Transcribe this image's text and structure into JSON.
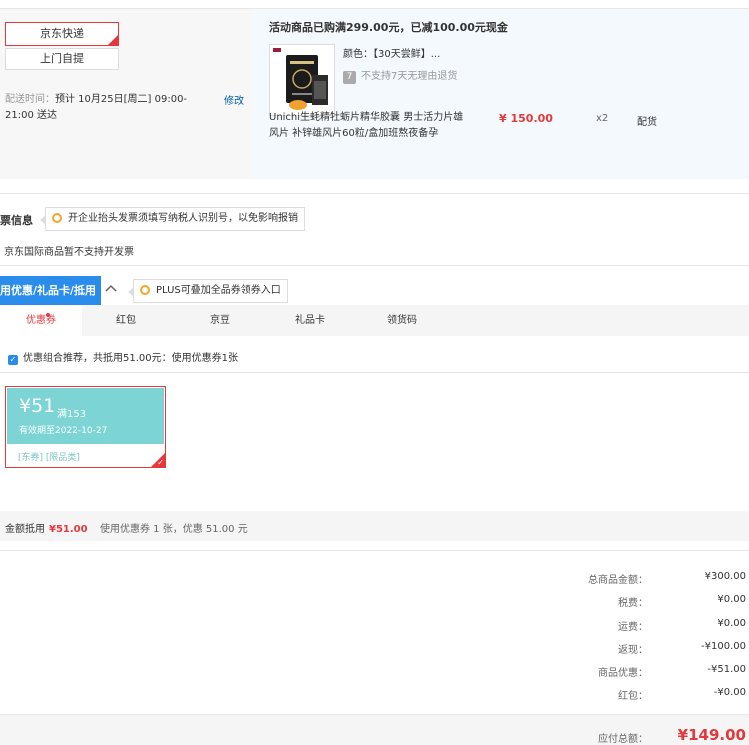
{
  "shipping": {
    "express_label": "京东快递",
    "pickup_label": "上门自提",
    "delivery_time_label": "配送时间：",
    "delivery_time_value": "预计 10月25日[周二] 09:00-21:00 送达",
    "modify_label": "修改"
  },
  "product": {
    "promo_title": "活动商品已购满299.00元，已减100.00元现金",
    "color_text": "颜色：【30天尝鲜】...",
    "no_return_text": "不支持7天无理由退货",
    "name": "Unichi生蚝精牡蛎片精华胶囊 男士活力片雄风片 补锌雄风片60粒/盒加班熬夜备孕",
    "price": "¥ 150.00",
    "qty": "x2",
    "stock": "配货"
  },
  "invoice": {
    "label": "票信息",
    "tip": "开企业抬头发票须填写纳税人识别号，以免影响报销",
    "note": "京东国际商品暂不支持开发票"
  },
  "coupons": {
    "header": "用优惠/礼品卡/抵用",
    "plus_tip": "PLUS可叠加全品券领券入口",
    "tabs": [
      {
        "label": "优惠券"
      },
      {
        "label": "红包"
      },
      {
        "label": "京豆"
      },
      {
        "label": "礼品卡"
      },
      {
        "label": "领货码"
      }
    ],
    "combo_text": "优惠组合推荐，共抵用51.00元：使用优惠券1张",
    "card": {
      "amount": "¥51",
      "condition": "满153",
      "expiry": "有效期至2022-10-27",
      "tags": "[东券] [限品类]"
    },
    "summary_label": "金额抵用",
    "summary_amount": "¥51.00",
    "summary_desc": "使用优惠券 1 张，优惠 51.00 元"
  },
  "totals": [
    {
      "label": "总商品金额：",
      "value": "¥300.00"
    },
    {
      "label": "税费：",
      "value": "¥0.00"
    },
    {
      "label": "运费：",
      "value": "¥0.00"
    },
    {
      "label": "返现：",
      "value": "-¥100.00"
    },
    {
      "label": "商品优惠：",
      "value": "-¥51.00"
    },
    {
      "label": "红包：",
      "value": "-¥0.00"
    }
  ],
  "payable": {
    "label": "应付总额：",
    "value": "¥149.00"
  },
  "colors": {
    "accent": "#e4393c",
    "blue": "#2a8dec",
    "coupon": "#7cd4d4"
  },
  "icons": {
    "no_return": "no-return-icon",
    "bulb": "bulb-icon",
    "chevron": "chevron-up-icon",
    "check": "check-icon"
  }
}
